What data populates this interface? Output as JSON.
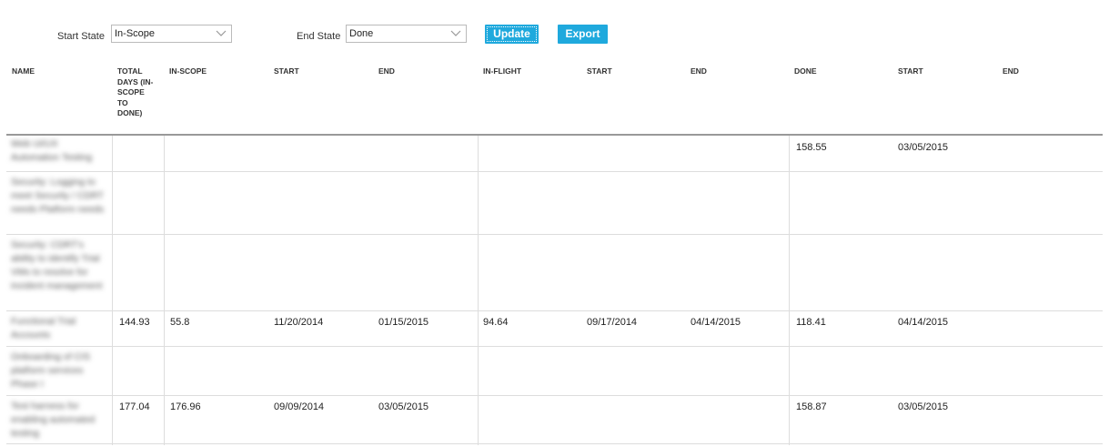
{
  "controls": {
    "start_label": "Start State",
    "start_value": "In-Scope",
    "end_label": "End State",
    "end_value": "Done",
    "update_label": "Update",
    "export_label": "Export"
  },
  "table": {
    "headers": {
      "name": "NAME",
      "total_days": "TOTAL DAYS (IN-SCOPE TO DONE)",
      "in_scope": "IN-SCOPE",
      "in_scope_start": "START",
      "in_scope_end": "END",
      "in_flight": "IN-FLIGHT",
      "in_flight_start": "START",
      "in_flight_end": "END",
      "done": "DONE",
      "done_start": "START",
      "done_end": "END"
    },
    "rows": [
      {
        "name": "Web Ui/UX Automation Testing",
        "total": "",
        "in_scope": "",
        "is_start": "",
        "is_end": "",
        "in_flight": "",
        "if_start": "",
        "if_end": "",
        "done": "158.55",
        "d_start": "03/05/2015",
        "d_end": ""
      },
      {
        "name": "Security: Logging to meet Security / CDRT needs Platform needs",
        "total": "",
        "in_scope": "",
        "is_start": "",
        "is_end": "",
        "in_flight": "",
        "if_start": "",
        "if_end": "",
        "done": "",
        "d_start": "",
        "d_end": ""
      },
      {
        "name": "Security: CDRT's ability to identify Trial VMs to resolve for incident management",
        "total": "",
        "in_scope": "",
        "is_start": "",
        "is_end": "",
        "in_flight": "",
        "if_start": "",
        "if_end": "",
        "done": "",
        "d_start": "",
        "d_end": ""
      },
      {
        "name": "Functional Trial Accounts",
        "total": "144.93",
        "in_scope": "55.8",
        "is_start": "11/20/2014",
        "is_end": "01/15/2015",
        "in_flight": "94.64",
        "if_start": "09/17/2014",
        "if_end": "04/14/2015",
        "done": "118.41",
        "d_start": "04/14/2015",
        "d_end": ""
      },
      {
        "name": "Onboarding of CIS platform services Phase I",
        "total": "",
        "in_scope": "",
        "is_start": "",
        "is_end": "",
        "in_flight": "",
        "if_start": "",
        "if_end": "",
        "done": "",
        "d_start": "",
        "d_end": ""
      },
      {
        "name": "Test harness for enabling automated testing",
        "total": "177.04",
        "in_scope": "176.96",
        "is_start": "09/09/2014",
        "is_end": "03/05/2015",
        "in_flight": "",
        "if_start": "",
        "if_end": "",
        "done": "158.87",
        "d_start": "03/05/2015",
        "d_end": ""
      }
    ]
  }
}
